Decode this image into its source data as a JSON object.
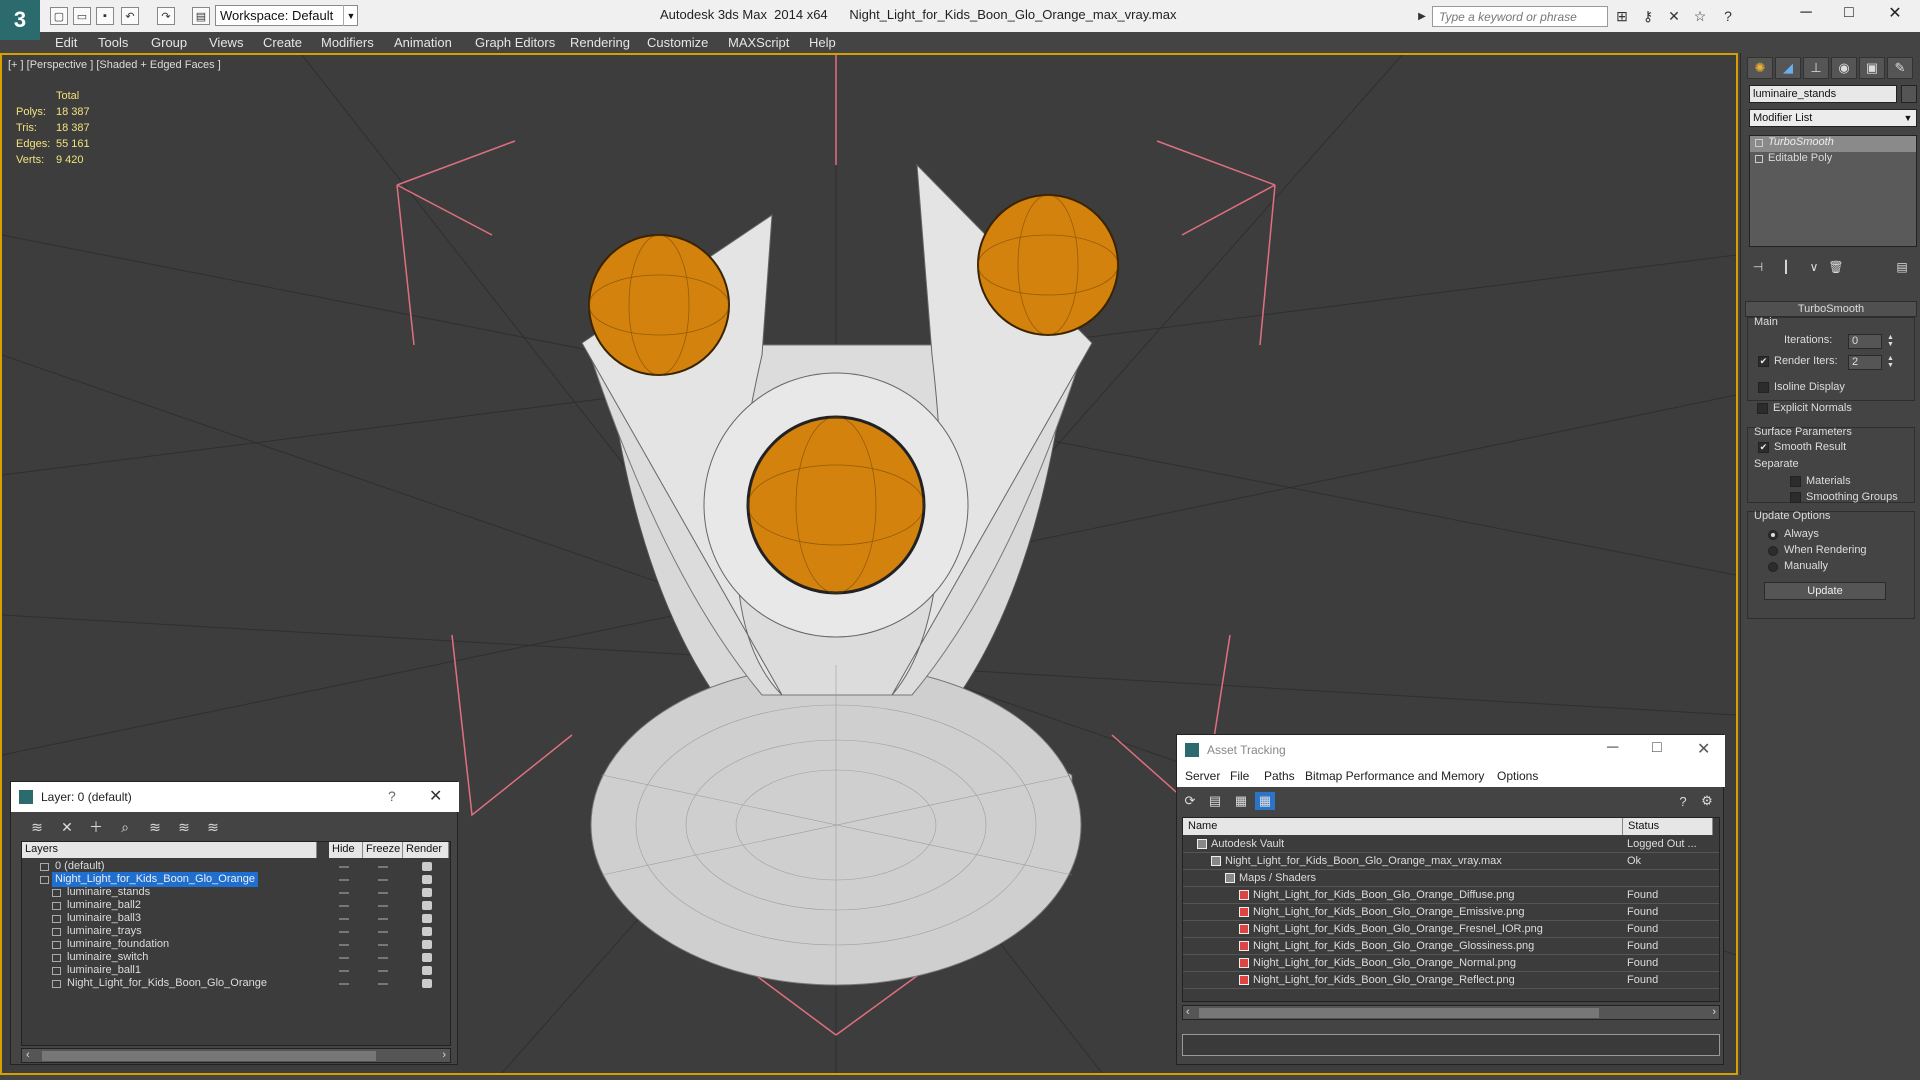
{
  "titlebar": {
    "workspace": "Workspace: Default",
    "title": "Autodesk 3ds Max  2014 x64      Night_Light_for_Kids_Boon_Glo_Orange_max_vray.max",
    "search_placeholder": "Type a keyword or phrase"
  },
  "menu": [
    "Edit",
    "Tools",
    "Group",
    "Views",
    "Create",
    "Modifiers",
    "Animation",
    "Graph Editors",
    "Rendering",
    "Customize",
    "MAXScript",
    "Help"
  ],
  "viewport": {
    "label": "[+ ] [Perspective ] [Shaded + Edged Faces ]",
    "stats_header": "Total",
    "stats": [
      {
        "k": "Polys:",
        "v": "18 387"
      },
      {
        "k": "Tris:",
        "v": "18 387"
      },
      {
        "k": "Edges:",
        "v": "55 161"
      },
      {
        "k": "Verts:",
        "v": "9 420"
      }
    ]
  },
  "command_panel": {
    "object_name": "luminaire_stands",
    "modifier_list": "Modifier List",
    "stack": [
      "TurboSmooth",
      "Editable Poly"
    ],
    "rollout_title": "TurboSmooth",
    "main_group": "Main",
    "iterations_label": "Iterations:",
    "iterations_value": "0",
    "render_iters_label": "Render Iters:",
    "render_iters_value": "2",
    "isoline": "Isoline Display",
    "explicit_normals": "Explicit Normals",
    "surface_group": "Surface Parameters",
    "smooth_result": "Smooth Result",
    "separate": "Separate",
    "materials": "Materials",
    "smoothing_groups": "Smoothing Groups",
    "update_group": "Update Options",
    "always": "Always",
    "when_rendering": "When Rendering",
    "manually": "Manually",
    "update_button": "Update"
  },
  "layer_dialog": {
    "title": "Layer: 0 (default)",
    "help": "?",
    "columns": [
      "Layers",
      "Hide",
      "Freeze",
      "Render"
    ],
    "rows": [
      {
        "name": "0 (default)",
        "level": 1,
        "selected": false
      },
      {
        "name": "Night_Light_for_Kids_Boon_Glo_Orange",
        "level": 1,
        "selected": true
      },
      {
        "name": "luminaire_stands",
        "level": 2,
        "selected": false
      },
      {
        "name": "luminaire_ball2",
        "level": 2,
        "selected": false
      },
      {
        "name": "luminaire_ball3",
        "level": 2,
        "selected": false
      },
      {
        "name": "luminaire_trays",
        "level": 2,
        "selected": false
      },
      {
        "name": "luminaire_foundation",
        "level": 2,
        "selected": false
      },
      {
        "name": "luminaire_switch",
        "level": 2,
        "selected": false
      },
      {
        "name": "luminaire_ball1",
        "level": 2,
        "selected": false
      },
      {
        "name": "Night_Light_for_Kids_Boon_Glo_Orange",
        "level": 2,
        "selected": false
      }
    ]
  },
  "asset_dialog": {
    "title": "Asset Tracking",
    "menu": [
      "Server",
      "File",
      "Paths",
      "Bitmap Performance and Memory",
      "Options"
    ],
    "columns": [
      "Name",
      "Status"
    ],
    "rows": [
      {
        "name": "Autodesk Vault",
        "status": "Logged Out ...",
        "level": 0
      },
      {
        "name": "Night_Light_for_Kids_Boon_Glo_Orange_max_vray.max",
        "status": "Ok",
        "level": 1
      },
      {
        "name": "Maps / Shaders",
        "status": "",
        "level": 2
      },
      {
        "name": "Night_Light_for_Kids_Boon_Glo_Orange_Diffuse.png",
        "status": "Found",
        "level": 3
      },
      {
        "name": "Night_Light_for_Kids_Boon_Glo_Orange_Emissive.png",
        "status": "Found",
        "level": 3
      },
      {
        "name": "Night_Light_for_Kids_Boon_Glo_Orange_Fresnel_IOR.png",
        "status": "Found",
        "level": 3
      },
      {
        "name": "Night_Light_for_Kids_Boon_Glo_Orange_Glossiness.png",
        "status": "Found",
        "level": 3
      },
      {
        "name": "Night_Light_for_Kids_Boon_Glo_Orange_Normal.png",
        "status": "Found",
        "level": 3
      },
      {
        "name": "Night_Light_for_Kids_Boon_Glo_Orange_Reflect.png",
        "status": "Found",
        "level": 3
      }
    ]
  },
  "colors": {
    "viewport_border": "#d7a000",
    "stats_text": "#f2e27c",
    "ball": "#d4820e",
    "selection": "#1f6fd1"
  }
}
